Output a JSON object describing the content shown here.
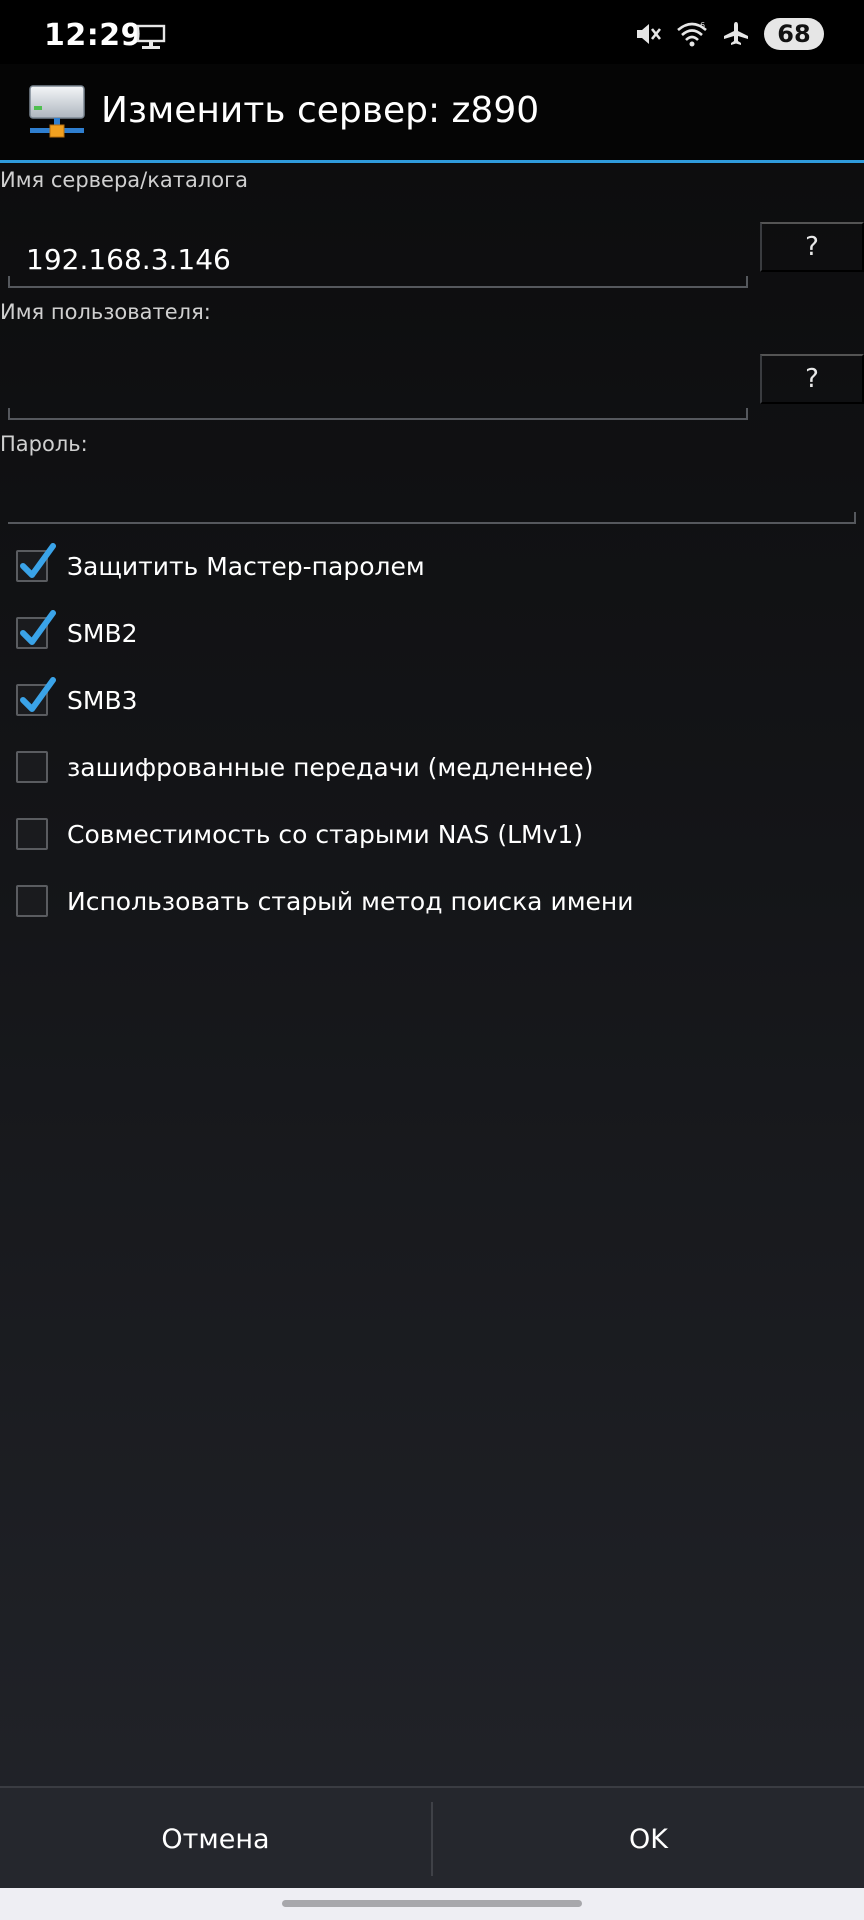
{
  "status_bar": {
    "time": "12:29",
    "battery": "68",
    "icons": [
      "desktop-icon",
      "mute-icon",
      "wifi-icon",
      "airplane-icon"
    ]
  },
  "title_bar": {
    "icon": "server-icon",
    "title": "Изменить сервер: z890"
  },
  "form": {
    "server": {
      "label": "Имя сервера/каталога",
      "value": "192.168.3.146",
      "help": "?"
    },
    "username": {
      "label": "Имя пользователя:",
      "value": "",
      "help": "?"
    },
    "password": {
      "label": "Пароль:",
      "value": ""
    }
  },
  "options": [
    {
      "label": "Защитить Мастер-паролем",
      "checked": true
    },
    {
      "label": "SMB2",
      "checked": true
    },
    {
      "label": "SMB3",
      "checked": true
    },
    {
      "label": "зашифрованные передачи (медленнее)",
      "checked": false
    },
    {
      "label": "Совместимость со старыми NAS (LMv1)",
      "checked": false
    },
    {
      "label": "Использовать старый метод поиска имени",
      "checked": false
    }
  ],
  "buttons": {
    "cancel": "Отмена",
    "ok": "OK"
  },
  "colors": {
    "accent": "#2f9bdc",
    "check": "#3aa3e8"
  }
}
